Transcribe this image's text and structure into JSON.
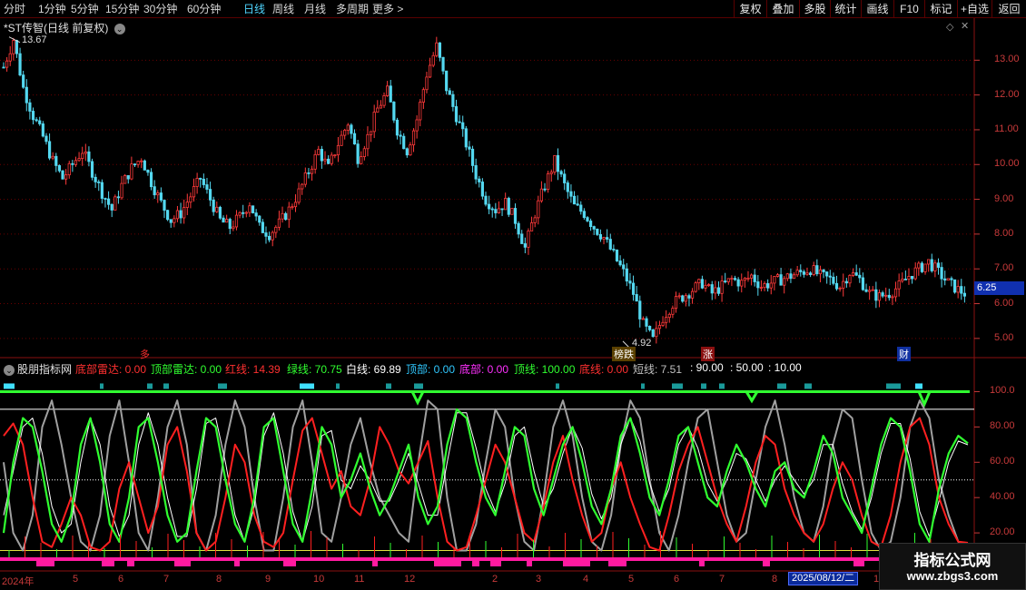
{
  "toolbar": {
    "periods": [
      "分时",
      "1分钟",
      "5分钟",
      "15分钟",
      "30分钟",
      "60分钟",
      "日线",
      "周线",
      "月线",
      "多周期",
      "更多 >"
    ],
    "selected_period": "日线",
    "right_buttons": [
      "复权",
      "叠加",
      "多股",
      "统计",
      "画线",
      "F10",
      "标记",
      "+自选",
      "返回"
    ]
  },
  "price_pane": {
    "title": "*ST传智(日线 前复权)",
    "high_label": "13.67",
    "low_label": "4.92",
    "current_price": "6.25",
    "axis_ticks": [
      "13.00",
      "12.00",
      "11.00",
      "10.00",
      "9.00",
      "8.00",
      "7.00",
      "6.00",
      "5.00"
    ],
    "markers": [
      {
        "text": "多",
        "color": "#ff3030"
      },
      {
        "text": "榜跌",
        "color": "#ffffff"
      },
      {
        "text": "涨",
        "color": "#ffffff"
      },
      {
        "text": "财",
        "color": "#ffffff"
      }
    ]
  },
  "indicator_pane": {
    "name": "股朋指标网",
    "legend": [
      {
        "label": "底部雷达: 0.00",
        "color": "#ff3030"
      },
      {
        "label": "顶部雷达: 0.00",
        "color": "#30ff30"
      },
      {
        "label": "红线: 14.39",
        "color": "#ff3030"
      },
      {
        "label": "绿线: 70.75",
        "color": "#30ff30"
      },
      {
        "label": "白线: 69.89",
        "color": "#ffffff"
      },
      {
        "label": "顶部: 0.00",
        "color": "#30c8ff"
      },
      {
        "label": "底部: 0.00",
        "color": "#ff30ff"
      },
      {
        "label": "顶线: 100.00",
        "color": "#30ff30"
      },
      {
        "label": "底线: 0.00",
        "color": "#ff3030"
      },
      {
        "label": "短线: 7.51",
        "color": "#c0c0c0"
      },
      {
        "label": ": 90.00",
        "color": "#ffffff"
      },
      {
        "label": ": 50.00",
        "color": "#ffffff"
      },
      {
        "label": ": 10.00",
        "color": "#ffffff"
      }
    ],
    "axis_ticks": [
      "100.0",
      "80.00",
      "60.00",
      "40.00",
      "20.00"
    ]
  },
  "x_axis": {
    "labels": [
      "2024年",
      "5",
      "6",
      "7",
      "8",
      "9",
      "10",
      "11",
      "12",
      "2",
      "3",
      "4",
      "5",
      "6",
      "7",
      "8",
      "10"
    ],
    "cursor_date": "2025/08/12/二"
  },
  "watermark": {
    "line1": "指标公式网",
    "line2": "www.zbgs3.com"
  },
  "colors": {
    "up": "#ff3a3a",
    "down": "#54d8f0",
    "green_line": "#30ff30",
    "red_line": "#ff2020",
    "white_line": "#ffffff",
    "gray_line": "#a0a0a0",
    "magenta": "#ff1aa0",
    "teal": "#1a9a9a"
  },
  "chart_data": {
    "type": "line",
    "series": [
      {
        "name": "price_close",
        "values": [
          12.8,
          13.6,
          12.2,
          11.4,
          10.8,
          10.1,
          9.6,
          10.0,
          10.4,
          9.8,
          9.2,
          8.7,
          9.4,
          9.9,
          10.2,
          9.5,
          8.9,
          8.4,
          8.6,
          9.1,
          9.6,
          9.0,
          8.4,
          8.2,
          8.5,
          8.9,
          8.2,
          8.0,
          8.3,
          8.7,
          9.2,
          9.8,
          10.4,
          9.9,
          10.6,
          11.2,
          10.2,
          10.8,
          11.6,
          12.1,
          11.0,
          10.4,
          11.3,
          12.6,
          13.4,
          12.2,
          11.4,
          10.6,
          9.7,
          9.0,
          8.7,
          8.9,
          8.4,
          7.6,
          8.6,
          9.4,
          10.1,
          9.4,
          8.8,
          8.6,
          8.2,
          7.9,
          7.4,
          6.9,
          6.3,
          5.4,
          4.95,
          5.6,
          6.0,
          6.2,
          6.4,
          6.6,
          6.3,
          6.5,
          6.7,
          6.6,
          6.8,
          6.5,
          6.6,
          6.7,
          6.8,
          6.9,
          7.0,
          6.8,
          6.7,
          6.5,
          6.9,
          6.7,
          6.3,
          6.2,
          6.3,
          6.5,
          6.8,
          7.0,
          7.2,
          6.9,
          6.6,
          6.4,
          6.25
        ]
      },
      {
        "name": "红线",
        "values": [
          75,
          82,
          70,
          40,
          15,
          12,
          25,
          40,
          30,
          12,
          10,
          15,
          45,
          60,
          40,
          20,
          35,
          70,
          80,
          55,
          20,
          10,
          15,
          40,
          70,
          60,
          30,
          15,
          12,
          20,
          50,
          78,
          85,
          65,
          45,
          55,
          35,
          30,
          50,
          80,
          70,
          55,
          48,
          60,
          72,
          40,
          15,
          10,
          12,
          30,
          50,
          70,
          60,
          40,
          20,
          15,
          35,
          60,
          75,
          50,
          30,
          15,
          20,
          45,
          60,
          40,
          25,
          12,
          10,
          30,
          55,
          70,
          80,
          60,
          40,
          25,
          15,
          35,
          60,
          75,
          70,
          45,
          30,
          20,
          15,
          25,
          45,
          60,
          50,
          30,
          15,
          12,
          30,
          60,
          80,
          85,
          70,
          40,
          25,
          15,
          14.39
        ]
      },
      {
        "name": "绿线",
        "values": [
          20,
          60,
          85,
          80,
          55,
          25,
          15,
          30,
          70,
          85,
          60,
          25,
          15,
          40,
          80,
          85,
          60,
          30,
          15,
          20,
          55,
          85,
          80,
          50,
          25,
          15,
          40,
          80,
          85,
          55,
          25,
          15,
          45,
          80,
          70,
          40,
          50,
          65,
          45,
          30,
          40,
          55,
          70,
          40,
          25,
          35,
          70,
          90,
          85,
          60,
          40,
          30,
          55,
          80,
          75,
          45,
          30,
          50,
          70,
          80,
          60,
          35,
          25,
          45,
          75,
          85,
          65,
          40,
          30,
          50,
          75,
          80,
          60,
          40,
          35,
          55,
          70,
          60,
          45,
          35,
          55,
          60,
          45,
          40,
          55,
          75,
          65,
          40,
          30,
          20,
          45,
          70,
          85,
          80,
          55,
          25,
          15,
          45,
          65,
          75,
          70.75
        ]
      },
      {
        "name": "白线",
        "values": [
          30,
          55,
          80,
          85,
          65,
          35,
          20,
          25,
          60,
          85,
          70,
          35,
          18,
          30,
          70,
          88,
          70,
          40,
          18,
          18,
          45,
          82,
          85,
          60,
          30,
          15,
          35,
          75,
          88,
          65,
          32,
          15,
          35,
          75,
          78,
          50,
          45,
          58,
          50,
          38,
          38,
          50,
          65,
          48,
          30,
          30,
          60,
          88,
          88,
          68,
          45,
          32,
          48,
          75,
          80,
          55,
          35,
          45,
          65,
          80,
          68,
          42,
          28,
          40,
          70,
          85,
          72,
          48,
          32,
          45,
          70,
          80,
          68,
          48,
          38,
          50,
          65,
          62,
          50,
          38,
          50,
          58,
          50,
          42,
          50,
          70,
          70,
          48,
          32,
          22,
          40,
          65,
          82,
          82,
          62,
          32,
          18,
          38,
          60,
          72,
          69.89
        ]
      },
      {
        "name": "短线",
        "values": [
          60,
          20,
          10,
          30,
          80,
          95,
          70,
          40,
          15,
          10,
          30,
          75,
          95,
          60,
          20,
          10,
          40,
          80,
          95,
          70,
          20,
          10,
          30,
          70,
          95,
          80,
          40,
          10,
          10,
          40,
          80,
          95,
          60,
          20,
          15,
          40,
          70,
          85,
          60,
          40,
          30,
          20,
          15,
          60,
          95,
          90,
          40,
          10,
          10,
          25,
          60,
          90,
          80,
          40,
          15,
          10,
          40,
          80,
          95,
          75,
          40,
          15,
          10,
          30,
          70,
          95,
          85,
          50,
          20,
          10,
          30,
          60,
          85,
          90,
          60,
          30,
          15,
          20,
          50,
          80,
          95,
          70,
          40,
          20,
          15,
          35,
          70,
          90,
          85,
          50,
          20,
          10,
          15,
          40,
          80,
          95,
          85,
          50,
          30,
          15,
          7.51
        ]
      }
    ],
    "xlabel": "",
    "ylabel": "",
    "ylim_price": [
      4.5,
      14.0
    ],
    "ylim_indicator": [
      0,
      110
    ]
  }
}
